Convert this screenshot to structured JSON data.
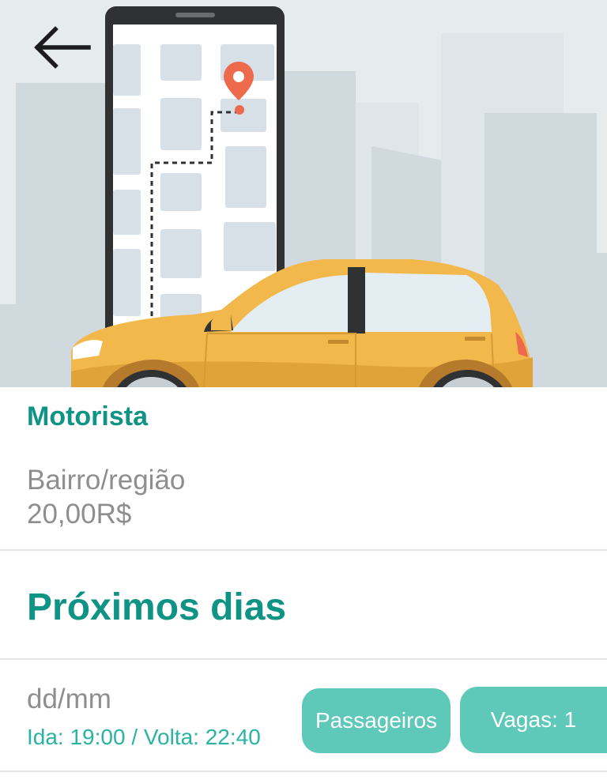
{
  "driver": {
    "role": "Motorista",
    "region": "Bairro/região",
    "price": "20,00R$"
  },
  "schedule": {
    "title": "Próximos dias",
    "trips": [
      {
        "date": "dd/mm",
        "times": "Ida: 19:00 / Volta: 22:40",
        "passengers_label": "Passageiros",
        "seats_label": "Vagas: 1"
      }
    ]
  },
  "icons": {
    "back": "arrow-left-icon",
    "hero": "car-and-map-illustration",
    "pin": "location-pin-icon"
  },
  "colors": {
    "accent": "#0e9384",
    "button": "#5ec8b9",
    "muted_text": "#8e8e8e",
    "car": "#f2b84b"
  }
}
